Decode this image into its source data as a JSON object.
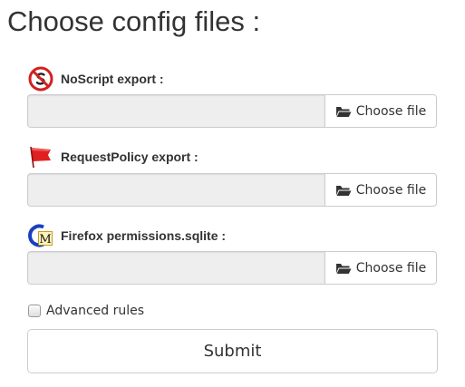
{
  "page": {
    "title": "Choose config files :"
  },
  "fields": [
    {
      "label": "NoScript export :",
      "icon": "noscript-icon",
      "input_value": "",
      "button_label": "Choose file",
      "button_icon": "folder-open-icon"
    },
    {
      "label": "RequestPolicy export :",
      "icon": "requestpolicy-flag-icon",
      "input_value": "",
      "button_label": "Choose file",
      "button_icon": "folder-open-icon"
    },
    {
      "label": "Firefox permissions.sqlite :",
      "icon": "cm-permissions-icon",
      "input_value": "",
      "button_label": "Choose file",
      "button_icon": "folder-open-icon"
    }
  ],
  "advanced": {
    "label": "Advanced rules",
    "checked": false
  },
  "submit": {
    "label": "Submit"
  },
  "colors": {
    "input_background": "#eeeeee",
    "border": "#cccccc",
    "text": "#333333",
    "flag_red": "#e02020",
    "noscript_red": "#d42020"
  }
}
